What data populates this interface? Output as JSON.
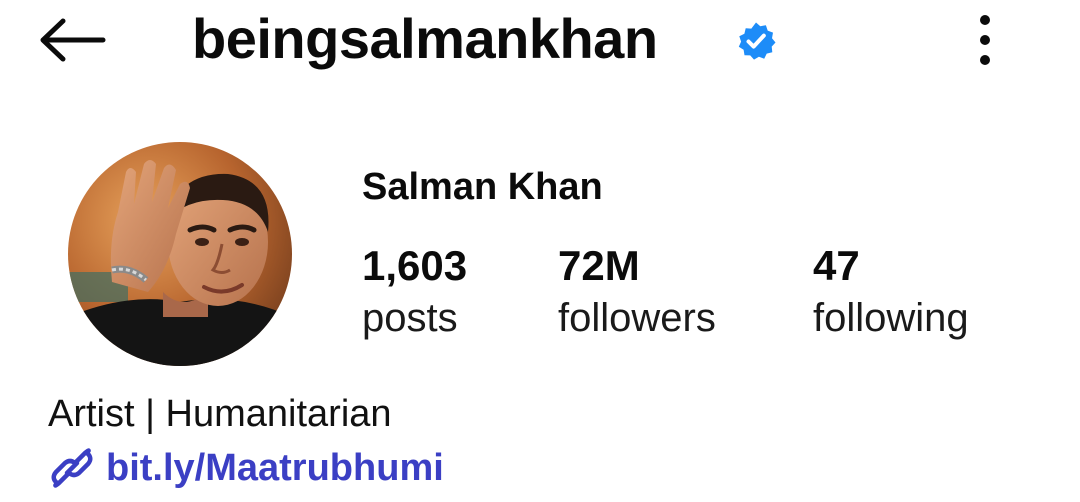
{
  "header": {
    "back_icon": "arrow-left-icon",
    "username": "beingsalmankhan",
    "verified_icon": "verified-badge-icon",
    "more_icon": "more-vertical-icon"
  },
  "profile": {
    "avatar_icon": "profile-photo",
    "full_name": "Salman Khan",
    "stats": {
      "posts": {
        "count": "1,603",
        "label": "posts"
      },
      "followers": {
        "count": "72M",
        "label": "followers"
      },
      "following": {
        "count": "47",
        "label": "following"
      }
    },
    "bio": "Artist | Humanitarian",
    "link": {
      "icon": "link-icon",
      "text": "bit.ly/Maatrubhumi"
    }
  },
  "colors": {
    "text": "#0b0b0b",
    "verified_blue": "#1d8cf8",
    "link_blue": "#3b3fc4",
    "background": "#ffffff"
  }
}
